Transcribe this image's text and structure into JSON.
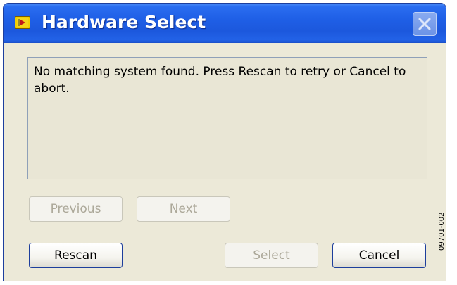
{
  "window": {
    "title": "Hardware Select",
    "app_icon": "labview-icon",
    "close_icon": "close-icon"
  },
  "message": {
    "text": "No matching system found. Press Rescan to retry or Cancel to abort."
  },
  "buttons": {
    "previous": {
      "label": "Previous",
      "enabled": false
    },
    "next": {
      "label": "Next",
      "enabled": false
    },
    "rescan": {
      "label": "Rescan",
      "enabled": true
    },
    "select": {
      "label": "Select",
      "enabled": false
    },
    "cancel": {
      "label": "Cancel",
      "enabled": true
    }
  },
  "figure_code": "09701-002",
  "colors": {
    "titlebar": "#1f5fe6",
    "dialog_background": "#ece9d8",
    "disabled_text": "#aca899"
  }
}
